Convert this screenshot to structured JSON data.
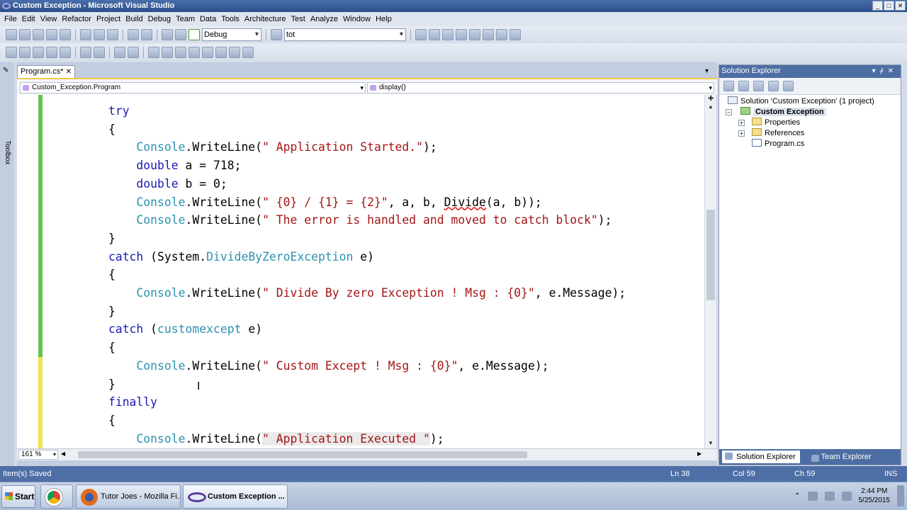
{
  "window": {
    "title": "Custom Exception - Microsoft Visual Studio"
  },
  "menu": [
    "File",
    "Edit",
    "View",
    "Refactor",
    "Project",
    "Build",
    "Debug",
    "Team",
    "Data",
    "Tools",
    "Architecture",
    "Test",
    "Analyze",
    "Window",
    "Help"
  ],
  "toolbar": {
    "config": "Debug",
    "find": "tot"
  },
  "toolbox": {
    "label": "Toolbox"
  },
  "editor": {
    "tab": "Program.cs*",
    "nav_left": "Custom_Exception.Program",
    "nav_right": "display()",
    "zoom": "161 %",
    "code_lines": [
      "        try",
      "        {",
      "            Console.WriteLine(\" Application Started.\");",
      "            double a = 718;",
      "            double b = 0;",
      "            Console.WriteLine(\" {0} / {1} = {2}\", a, b, Divide(a, b));",
      "            Console.WriteLine(\" The error is handled and moved to catch block\");",
      "        }",
      "        catch (System.DivideByZeroException e)",
      "        {",
      "            Console.WriteLine(\" Divide By zero Exception ! Msg : {0}\", e.Message);",
      "        }",
      "        catch (customexcept e)",
      "        {",
      "            Console.WriteLine(\" Custom Except ! Msg : {0}\", e.Message);",
      "        }",
      "        finally",
      "        {",
      "            Console.WriteLine(\" Application Executed \");"
    ]
  },
  "solution_explorer": {
    "title": "Solution Explorer",
    "solution": "Solution 'Custom Exception' (1 project)",
    "project": "Custom Exception",
    "items": [
      "Properties",
      "References",
      "Program.cs"
    ],
    "tabs": [
      "Solution Explorer",
      "Team Explorer"
    ]
  },
  "status": {
    "message": "Item(s) Saved",
    "ln": "Ln 38",
    "col": "Col 59",
    "ch": "Ch 59",
    "mode": "INS"
  },
  "taskbar": {
    "start": "Start",
    "items": [
      "Tutor Joes - Mozilla Fi...",
      "Custom Exception ..."
    ],
    "time": "2:44 PM",
    "date": "5/25/2015"
  }
}
